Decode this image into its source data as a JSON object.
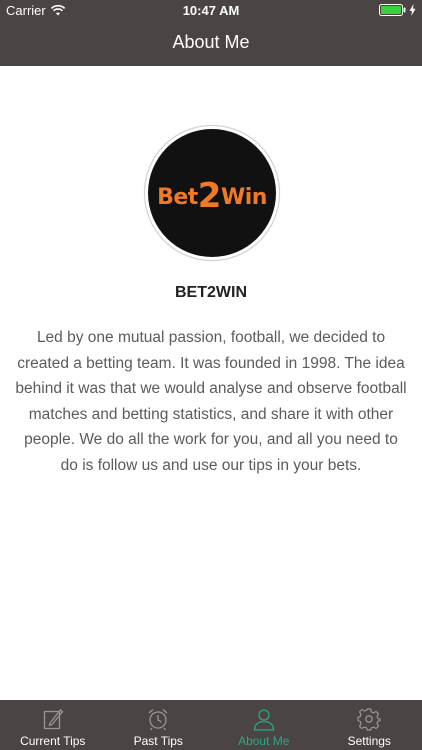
{
  "status_bar": {
    "carrier": "Carrier",
    "time": "10:47 AM",
    "icons": [
      "wifi-icon",
      "battery-icon",
      "charging-icon"
    ]
  },
  "header": {
    "title": "About Me"
  },
  "profile": {
    "logo_text_left": "Bet",
    "logo_text_num": "2",
    "logo_text_right": "Win",
    "logo_color": "#f07a24",
    "name": "BET2WIN",
    "description": "Led by one mutual passion, football, we decided to created a betting team. It was founded in 1998. The idea behind it was that we would analyse and observe football matches and betting statistics, and share it with other people. We do all the work for you, and all you need to do is follow us and use our tips in your bets."
  },
  "tabs": [
    {
      "label": "Current Tips",
      "icon": "edit-icon",
      "active": false
    },
    {
      "label": "Past Tips",
      "icon": "alarm-clock-icon",
      "active": false
    },
    {
      "label": "About Me",
      "icon": "user-icon",
      "active": true
    },
    {
      "label": "Settings",
      "icon": "gear-icon",
      "active": false
    }
  ],
  "colors": {
    "bar_background": "#4a4542",
    "active_tab": "#2aa68a",
    "text_body": "#5b5b5b"
  }
}
